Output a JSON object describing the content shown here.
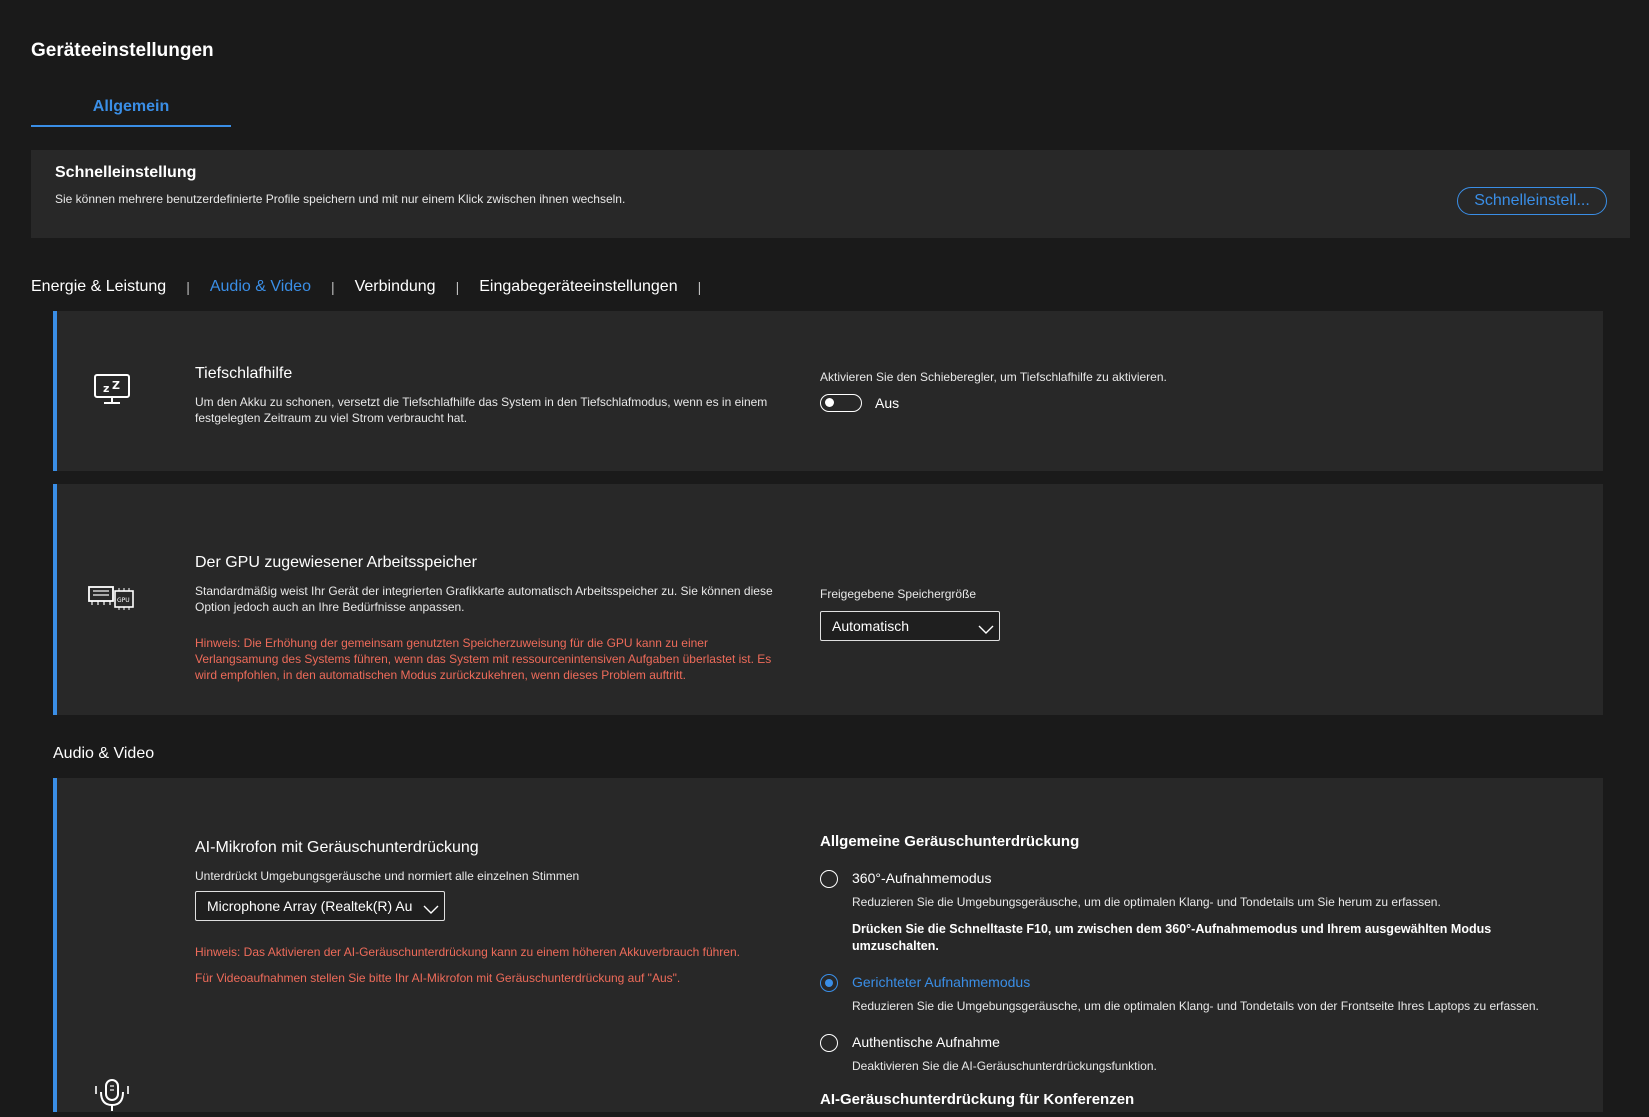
{
  "page": {
    "title": "Geräteeinstellungen"
  },
  "tabs": [
    {
      "label": "Allgemein"
    }
  ],
  "quick_settings": {
    "title": "Schnelleinstellung",
    "description": "Sie können mehrere benutzerdefinierte Profile speichern und mit nur einem Klick zwischen ihnen wechseln.",
    "button_label": "Schnelleinstell..."
  },
  "category_nav": [
    {
      "label": "Energie & Leistung",
      "active": false
    },
    {
      "label": "Audio & Video",
      "active": true
    },
    {
      "label": "Verbindung",
      "active": false
    },
    {
      "label": "Eingabegeräteeinstellungen",
      "active": false
    }
  ],
  "hibernation": {
    "icon": "monitor-sleep-icon",
    "title": "Tiefschlafhilfe",
    "description": "Um den Akku zu schonen, versetzt die Tiefschlafhilfe das System in den Tiefschlafmodus, wenn es in einem festgelegten Zeitraum zu viel Strom verbraucht hat.",
    "control_label": "Aktivieren Sie den Schieberegler, um Tiefschlafhilfe zu aktivieren.",
    "toggle_state": "Aus"
  },
  "gpu_memory": {
    "icon": "gpu-memory-icon",
    "title": "Der GPU zugewiesener Arbeitsspeicher",
    "description": "Standardmäßig weist Ihr Gerät der integrierten Grafikkarte automatisch Arbeitsspeicher zu. Sie können diese Option jedoch auch an Ihre Bedürfnisse anpassen.",
    "warning": "Hinweis: Die Erhöhung der gemeinsam genutzten Speicherzuweisung für die GPU kann zu einer Verlangsamung des Systems führen, wenn das System mit ressourcenintensiven Aufgaben überlastet ist. Es wird empfohlen, in den automatischen Modus zurückzukehren, wenn dieses Problem auftritt.",
    "select_label": "Freigegebene Speichergröße",
    "select_value": "Automatisch"
  },
  "audio_video": {
    "section_title": "Audio & Video",
    "ai_mic": {
      "icon": "microphone-icon",
      "title": "AI-Mikrofon mit Geräuschunterdrückung",
      "description": "Unterdrückt Umgebungsgeräusche und normiert alle einzelnen Stimmen",
      "select_value": "Microphone Array (Realtek(R) Audio)",
      "warning1": "Hinweis: Das Aktivieren der AI-Geräuschunterdrückung kann zu einem höheren Akkuverbrauch führen.",
      "warning2": "Für Videoaufnahmen stellen Sie bitte Ihr AI-Mikrofon mit Geräuschunterdrückung auf \"Aus\"."
    },
    "noise_reduction": {
      "title": "Allgemeine Geräuschunterdrückung",
      "options": [
        {
          "label": "360°-Aufnahmemodus",
          "description": "Reduzieren Sie die Umgebungsgeräusche, um die optimalen Klang- und Tondetails um Sie herum zu erfassen.",
          "note": "Drücken Sie die Schnelltaste F10, um zwischen dem 360°-Aufnahmemodus und Ihrem ausgewählten Modus umzuschalten.",
          "checked": false
        },
        {
          "label": "Gerichteter Aufnahmemodus",
          "description": "Reduzieren Sie die Umgebungsgeräusche, um die optimalen Klang- und Tondetails von der Frontseite Ihres Laptops zu erfassen.",
          "checked": true
        },
        {
          "label": "Authentische Aufnahme",
          "description": "Deaktivieren Sie die AI-Geräuschunterdrückungsfunktion.",
          "checked": false
        }
      ]
    },
    "conference_title": "AI-Geräuschunterdrückung für Konferenzen"
  },
  "colors": {
    "accent": "#3a8ee6",
    "warning": "#ee6b5a",
    "background": "#1a1a1a",
    "card": "#282828"
  }
}
